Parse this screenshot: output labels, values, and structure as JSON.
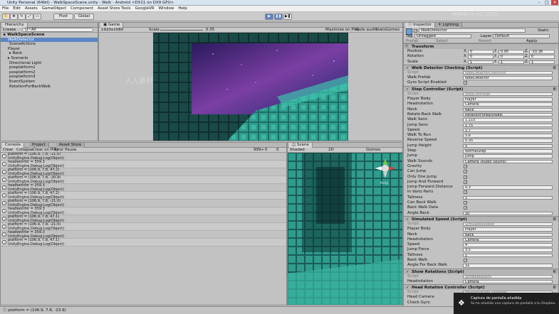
{
  "window": {
    "title": "Unity Personal (64bit) - WalkSpaceScene.unity - Walk - Android <DX11 on DX9 GPU>"
  },
  "menu": [
    "File",
    "Edit",
    "Assets",
    "GameObject",
    "Component",
    "Asset Store Tools",
    "GoogleVR",
    "Window",
    "Help"
  ],
  "toolbar": {
    "pivot": "Pivot",
    "global": "Global"
  },
  "hierarchy": {
    "tab": "Hierarchy",
    "create": "Create",
    "search": "Q~All",
    "root": "WalkSpaceScene",
    "items": [
      "WalkDetector",
      "SceneActions",
      "Player",
      "Neck",
      "Scenario",
      "Directional Light",
      "posplatform1",
      "posplatform2",
      "posplatform3",
      "EventSystem",
      "RotationForBackWalk"
    ]
  },
  "game": {
    "tab": "Game",
    "res": "1920x1080",
    "scale_label": "Scale",
    "scale_val": "0.35",
    "opts": [
      "Maximize on Play",
      "Mute audio",
      "Stats",
      "Gizmos"
    ]
  },
  "console": {
    "tabs": [
      "Console",
      "Project",
      "Asset Store"
    ],
    "buttons": [
      "Clear",
      "Collapse",
      "Clear on Play",
      "Error Pause"
    ],
    "counts": [
      "999+",
      "0",
      "0"
    ],
    "rows": [
      [
        "platform = (106.9, 7.8, -21.0)",
        "UnityEngine.Debug:Log(Object)"
      ],
      [
        "headeeinfor = 359.3",
        "UnityEngine.Debug:Log(Object)"
      ],
      [
        "platform = (106.9, 7.8, 47.2)",
        "UnityEngine.Debug:Log(Object)"
      ],
      [
        "platform = (106.9, 7.8, -20.9)",
        "UnityEngine.Debug:Log(Object)"
      ],
      [
        "headeeinfor = 359.3",
        "UnityEngine.Debug:Log(Object)"
      ],
      [
        "platform = (106.9, 7.8, 47.2)",
        "UnityEngine.Debug:Log(Object)"
      ],
      [
        "platform = (106.9, 7.8, -21.0)",
        "UnityEngine.Debug:Log(Object)"
      ],
      [
        "headeeinfor = 359.3",
        "UnityEngine.Debug:Log(Object)"
      ],
      [
        "platform = (106.9, 7.8, 47.1)",
        "UnityEngine.Debug:Log(Object)"
      ],
      [
        "platform = (106.9, 7.8, -21.0)",
        "UnityEngine.Debug:Log(Object)"
      ],
      [
        "headeeinfor = 359.3",
        "UnityEngine.Debug:Log(Object)"
      ],
      [
        "platform = (106.9, 7.8, 47.1)",
        "UnityEngine.Debug:Log(Object)"
      ]
    ],
    "status": "platform = (106.9, 7.8, -23.9)"
  },
  "scene": {
    "tab": "Scene",
    "shaded": "Shaded",
    "mode2d": "2D",
    "gizmos": "Gizmos",
    "persp": "Persp"
  },
  "inspector": {
    "tabs": [
      "Inspector",
      "Lighting"
    ],
    "name": "WalkDetector",
    "static": "Static",
    "tag_label": "Tag",
    "tag": "Untagged",
    "layer_label": "Layer",
    "layer": "Default",
    "prefab": "Prefab",
    "select": "Select",
    "revert": "Revert",
    "apply": "Apply",
    "transform": {
      "title": "Transform",
      "rows": [
        [
          "Position",
          "X",
          "0",
          "Y",
          "0.95",
          "Z",
          "-10.38"
        ],
        [
          "Rotation",
          "X",
          "0",
          "Y",
          "0",
          "Z",
          "0"
        ],
        [
          "Scale",
          "X",
          "1",
          "Y",
          "1",
          "Z",
          "1"
        ]
      ]
    },
    "components": [
      {
        "title": "Walk Detector Checking (Script)",
        "rows": [
          [
            "Script",
            "WalkDetectorChecking"
          ],
          [
            "Walk Prefab",
            "WalkDetector"
          ],
          [
            "Gyro Script Enabled",
            "✓"
          ]
        ]
      },
      {
        "title": "Step Controller (Script)",
        "rows": [
          [
            "Script",
            "StepController"
          ],
          [
            "Player Body",
            "Player"
          ],
          [
            "Headrotation",
            "Camera"
          ],
          [
            "Neck",
            "Neck"
          ],
          [
            "Rotate Back Walk",
            "RotationForBackWalk"
          ],
          [
            "Walk Sens",
            "1.115"
          ],
          [
            "Jump Sens",
            "1.75"
          ],
          [
            "Speed",
            "1.7"
          ],
          [
            "Walk To Run",
            "5.6"
          ],
          [
            "Reverse Speed",
            "0.35"
          ],
          [
            "Jump Height",
            "5"
          ],
          [
            "Step",
            "NormalStep"
          ],
          [
            "Jump",
            "Jump"
          ],
          [
            "Walk Sounds",
            "Camera (Audio Source)"
          ],
          [
            "Gravity",
            "✓"
          ],
          [
            "Can Jump",
            "✓"
          ],
          [
            "Only One Jump",
            "✓"
          ],
          [
            "Jump And Forward",
            "✓"
          ],
          [
            "Jump Forward Distance",
            "0.3"
          ],
          [
            "In Vario Parts",
            "✓"
          ],
          [
            "Tallness",
            "1"
          ],
          [
            "Can Back Walk",
            "✓"
          ],
          [
            "Back Walk Data",
            "✓"
          ],
          [
            "Angle Back",
            "20"
          ]
        ]
      },
      {
        "title": "Simulated Speed (Script)",
        "rows": [
          [
            "Script",
            "SimulatedSpeed"
          ],
          [
            "Player Body",
            "Player"
          ],
          [
            "Neck",
            "Neck"
          ],
          [
            "Headrotation",
            "Camera"
          ],
          [
            "Speed",
            "4"
          ],
          [
            "Jump Force",
            "3.5"
          ],
          [
            "Tallness",
            "1"
          ],
          [
            "Back Walk",
            "✓"
          ],
          [
            "Angle For Back Walk",
            "32"
          ]
        ]
      },
      {
        "title": "Show Rotations (Script)",
        "rows": [
          [
            "Script",
            "ShowRotations"
          ],
          [
            "Headrotation",
            "Camera"
          ]
        ]
      },
      {
        "title": "Head Rotation Controller (Script)",
        "rows": [
          [
            "Script",
            "HeadRotationController"
          ],
          [
            "Head Camera",
            "Camera"
          ],
          [
            "Check Gyro",
            "✓"
          ]
        ]
      }
    ]
  },
  "notification": {
    "title": "Captura de pantalla añadida",
    "body": "Se ha añadido una captura de pantalla a tu Dropbox."
  },
  "watermark": {
    "site": "www.rr-sc.com",
    "cn": "人人素材"
  }
}
